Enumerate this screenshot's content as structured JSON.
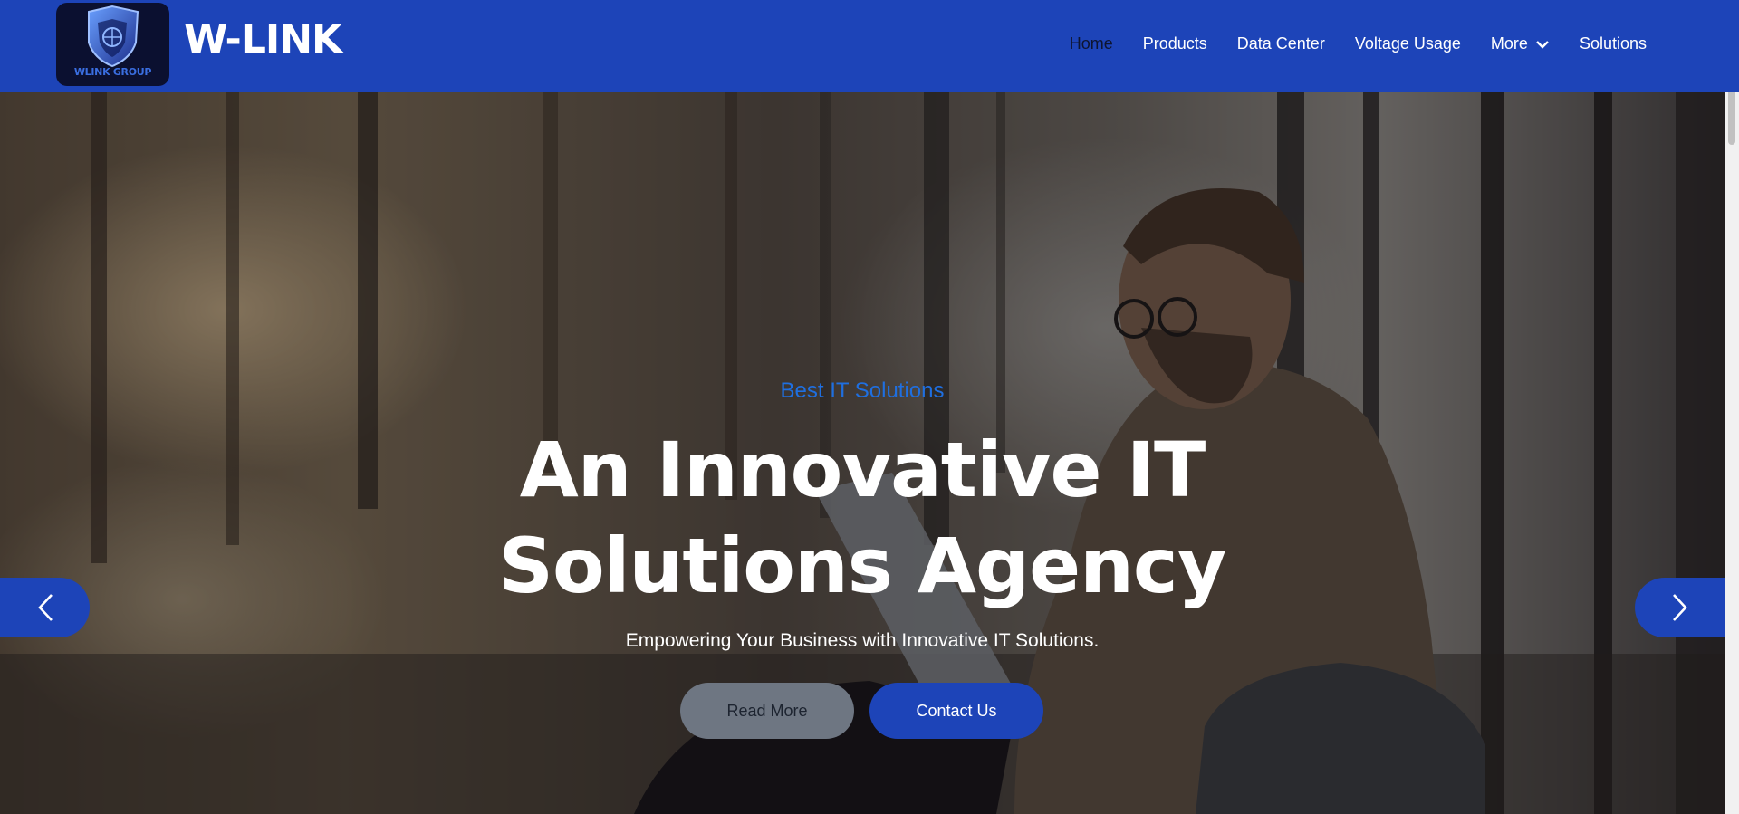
{
  "header": {
    "logo_caption": "WLINK GROUP",
    "brand": "W-LINK",
    "nav": [
      {
        "label": "Home",
        "active": true
      },
      {
        "label": "Products"
      },
      {
        "label": "Data Center"
      },
      {
        "label": "Voltage Usage"
      },
      {
        "label": "More",
        "has_dropdown": true
      },
      {
        "label": "Solutions"
      }
    ]
  },
  "hero": {
    "tagline": "Best IT Solutions",
    "headline": "An Innovative IT Solutions Agency",
    "subtext": "Empowering Your Business with Innovative IT Solutions.",
    "buttons": {
      "read_more": "Read More",
      "contact": "Contact Us"
    },
    "arrows": {
      "prev": "chevron-left-icon",
      "next": "chevron-right-icon"
    }
  },
  "colors": {
    "header_bg": "#1d44b8",
    "accent_blue": "#1f6fe0",
    "read_more_bg": "#6e7682",
    "contact_bg": "#1d44b8"
  }
}
